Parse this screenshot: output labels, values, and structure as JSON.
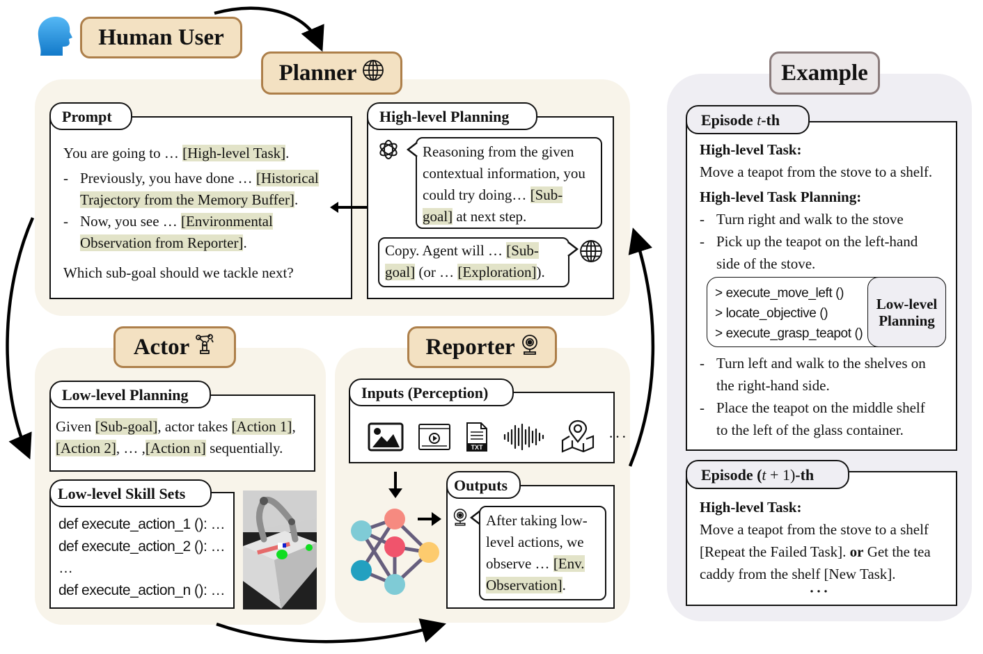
{
  "human_user": {
    "label": "Human User",
    "icon": "human-head-icon"
  },
  "planner": {
    "title": "Planner",
    "icon": "globe-icon",
    "prompt": {
      "tab": "Prompt",
      "line1_prefix": "You are going to … ",
      "line1_hl": "[High-level Task]",
      "line1_suffix": ".",
      "bullet1_prefix": "Previously, you have done … ",
      "bullet1_hl_a": "[Historical",
      "bullet1_hl_b": "Trajectory from the Memory Buffer]",
      "bullet1_suffix": ".",
      "bullet2_prefix": "Now, you see … ",
      "bullet2_hl_a": "[Environmental",
      "bullet2_hl_b": "Observation from Reporter]",
      "bullet2_suffix": ".",
      "question": "Which sub-goal should we tackle next?",
      "dash": "-"
    },
    "high_level_planning": {
      "tab": "High-level Planning",
      "llm_icon": "openai-logo-icon",
      "reply_l1": "Reasoning from the given",
      "reply_l2": "contextual information, you",
      "reply_l3_prefix": "could try doing… ",
      "reply_l3_hl": "[Sub-",
      "reply_l4_hl": "goal]",
      "reply_l4_suffix": " at next step.",
      "ack_l1_prefix": "Copy. Agent will … ",
      "ack_l1_hl": "[Sub-",
      "ack_l2_hl": "goal]",
      "ack_l2_mid": " (or … ",
      "ack_l2_hl2": "[Exploration]",
      "ack_l2_suffix": ").",
      "agent_icon": "globe-icon"
    }
  },
  "actor": {
    "title": "Actor",
    "icon": "robot-arm-icon",
    "low_level_planning": {
      "tab": "Low-level Planning",
      "l1_prefix": "Given ",
      "l1_hl1": "[Sub-goal]",
      "l1_mid": ", actor takes ",
      "l1_hl2": "[Action 1]",
      "l1_suffix": ",",
      "l2_hl1": "[Action 2]",
      "l2_mid": ", … ,",
      "l2_hl2": "[Action n]",
      "l2_suffix": " sequentially."
    },
    "skill_sets": {
      "tab": "Low-level Skill Sets",
      "lines": [
        "def execute_action_1 (): …",
        "def execute_action_2 (): …",
        "…",
        "def execute_action_n (): …"
      ]
    },
    "sim_image": "robot-arm-simulation-image"
  },
  "reporter": {
    "title": "Reporter",
    "icon": "webcam-icon",
    "inputs": {
      "tab": "Inputs (Perception)",
      "icons": [
        "image-icon",
        "video-icon",
        "txt-file-icon",
        "audio-waveform-icon",
        "map-pin-icon"
      ],
      "more": "···"
    },
    "network_icon": "neural-network-icon",
    "outputs": {
      "tab": "Outputs",
      "l1": "After taking low-",
      "l2": "level actions, we",
      "l3_prefix": "observe … ",
      "l3_hl": "[Env.",
      "l4_hl": "Observation]",
      "l4_suffix": "."
    }
  },
  "example": {
    "title": "Example",
    "episode_t": {
      "tab_prefix": "Episode ",
      "tab_var": "t",
      "tab_suffix": "-th",
      "task_label": "High-level Task:",
      "task": "Move a teapot from the stove to a shelf.",
      "planning_label": "High-level Task Planning:",
      "steps": [
        [
          "Turn right and walk to the stove"
        ],
        [
          "Pick up the teapot on the left-hand",
          "side of the stove."
        ],
        [
          "Turn left and walk to the shelves on",
          "the right-hand side."
        ],
        [
          "Place the teapot on the middle shelf",
          "to the left of the glass container."
        ]
      ],
      "low_level": {
        "calls": [
          "> execute_move_left ()",
          "> locate_objective ()",
          "> execute_grasp_teapot ()"
        ],
        "label_l1": "Low-level",
        "label_l2": "Planning"
      }
    },
    "episode_t1": {
      "tab_prefix": "Episode (",
      "tab_var": "t",
      "tab_math": " + 1)",
      "tab_suffix": "-th",
      "task_label": "High-level Task:",
      "l1": "Move a teapot from the stove to a shelf",
      "l2_a": "[Repeat the Failed Task]. ",
      "l2_or": "or",
      "l2_b": " Get the tea",
      "l3": "caddy from the shelf [New Task].",
      "more": "···"
    }
  },
  "colors": {
    "tag_fill": "#f3e1c2",
    "tag_border": "#ad7f4a",
    "panel_bg": "#f8f4ea",
    "example_bg": "#efeef3",
    "highlight": "#e2e3c8",
    "human_blue": "#2f9fe8"
  }
}
